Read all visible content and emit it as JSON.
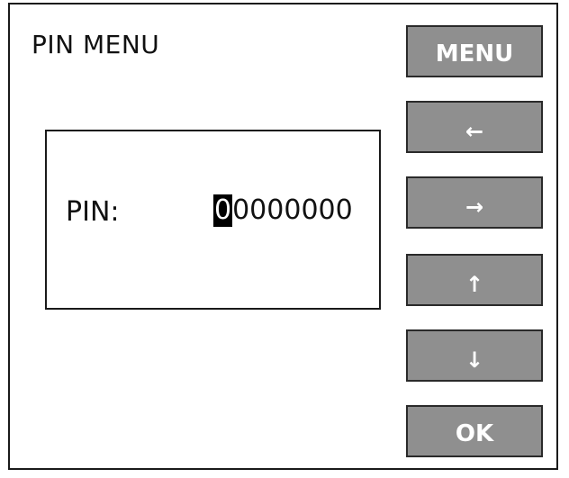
{
  "screen": {
    "title": "PIN MENU"
  },
  "pin": {
    "label": "PIN:",
    "selected_digit": "0",
    "remaining_digits": "0000000"
  },
  "buttons": {
    "menu": "MENU",
    "left_icon": "←",
    "right_icon": "→",
    "up_icon": "↑",
    "down_icon": "↓",
    "ok": "OK"
  },
  "colors": {
    "button_fill": "#8f8f8f",
    "button_text": "#ffffff",
    "cursor_highlight": "#000000"
  }
}
